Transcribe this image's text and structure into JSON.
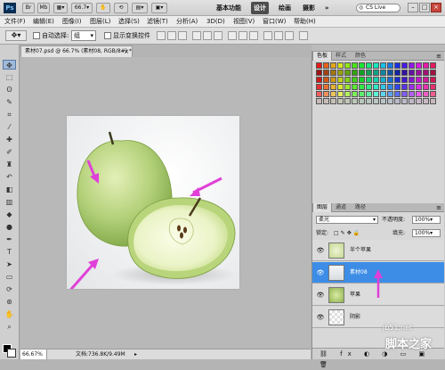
{
  "appbar": {
    "logo": "Ps",
    "zoom_value": "66.7",
    "workspaces": [
      "基本功能",
      "设计",
      "绘画",
      "摄影"
    ],
    "active_workspace": "设计",
    "more": "»",
    "cslive": "CS Live",
    "window_controls": [
      "–",
      "□",
      "×"
    ]
  },
  "menubar": {
    "items": [
      "文件(F)",
      "编辑(E)",
      "图像(I)",
      "图层(L)",
      "选择(S)",
      "滤镜(T)",
      "分析(A)",
      "3D(D)",
      "视图(V)",
      "窗口(W)",
      "帮助(H)"
    ]
  },
  "optbar": {
    "auto_select_label": "自动选择:",
    "auto_select_value": "组",
    "transform_controls_label": "显示变换控件"
  },
  "document": {
    "tab_title": "素材07.psd @ 66.7% (素材08, RGB/8#) *",
    "close": "×"
  },
  "statusbar": {
    "zoom": "66.67%",
    "doc_info": "文档:736.8K/9.49M"
  },
  "panels": {
    "swatch_tabs": [
      "色板",
      "样式",
      "颜色"
    ],
    "layers_tabs": [
      "图层",
      "通道",
      "路径"
    ],
    "blend_mode": "柔光",
    "opacity_label": "不透明度:",
    "opacity_value": "100%",
    "lock_label": "锁定:",
    "fill_label": "填充:",
    "fill_value": "100%",
    "layers": [
      {
        "name": "半个苹果",
        "selected": false
      },
      {
        "name": "素材08",
        "selected": true
      },
      {
        "name": "苹果",
        "selected": false
      },
      {
        "name": "阴影",
        "selected": false
      }
    ]
  },
  "watermark": {
    "line1": "jb51.net",
    "line2": "脚本之家"
  },
  "colors": {
    "annotation_arrow": "#e040d8",
    "selected_layer": "#3d8de6",
    "apple_green": "#a8cc6a"
  }
}
